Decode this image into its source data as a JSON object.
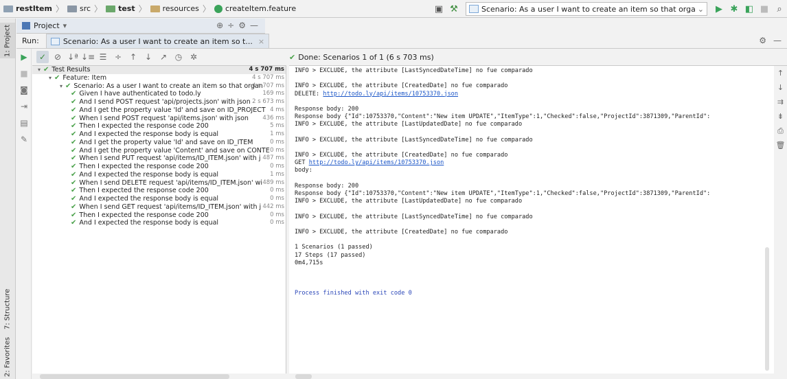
{
  "breadcrumb": [
    {
      "label": "restItem",
      "bold": true,
      "icon": "project-folder-icon",
      "cls": ""
    },
    {
      "label": "src",
      "bold": false,
      "icon": "folder-icon",
      "cls": "src"
    },
    {
      "label": "test",
      "bold": true,
      "icon": "test-folder-icon",
      "cls": "test"
    },
    {
      "label": "resources",
      "bold": false,
      "icon": "resources-folder-icon",
      "cls": "res"
    },
    {
      "label": "createItem.feature",
      "bold": false,
      "icon": "cucumber-feature-icon",
      "cls": "feat"
    }
  ],
  "toolbar": {
    "run_config": "Scenario: As a user I want to create an item so that organize my project"
  },
  "left_strip": {
    "project_tab": "1: Project",
    "structure_tab": "7: Structure",
    "favorites_tab": "2: Favorites"
  },
  "project_panel": {
    "title": "Project",
    "dropdown": "▾"
  },
  "run_panel": {
    "label": "Run:",
    "tab_title": "Scenario: As a user I want to create an item so t..."
  },
  "status": {
    "done_text": "Done: Scenarios 1 of 1  (6 s 703 ms)"
  },
  "tree": [
    {
      "indent": 0,
      "expander": "▾",
      "label": "Test Results",
      "time": "4 s 707 ms",
      "selected": true
    },
    {
      "indent": 1,
      "expander": "▾",
      "label": "Feature: Item",
      "time": "4 s 707 ms"
    },
    {
      "indent": 2,
      "expander": "▾",
      "label": "Scenario: As a user I want to create an item so that organ",
      "time": "4 s 707 ms"
    },
    {
      "indent": 3,
      "label": "Given I have authenticated to todo.ly",
      "time": "169 ms"
    },
    {
      "indent": 3,
      "label": "And I send POST request 'api/projects.json' with json",
      "time": "2 s 673 ms"
    },
    {
      "indent": 3,
      "label": "And I get the property value 'Id' and save on ID_PROJECT",
      "time": "4 ms"
    },
    {
      "indent": 3,
      "label": "When I send POST request 'api/items.json' with json",
      "time": "436 ms"
    },
    {
      "indent": 3,
      "label": "Then I expected the response code 200",
      "time": "5 ms"
    },
    {
      "indent": 3,
      "label": "And I expected the response body is equal",
      "time": "1 ms"
    },
    {
      "indent": 3,
      "label": "And I get the property value 'Id' and save on ID_ITEM",
      "time": "0 ms"
    },
    {
      "indent": 3,
      "label": "And I get the property value 'Content' and save on CONTE",
      "time": "0 ms"
    },
    {
      "indent": 3,
      "label": "When I send PUT request 'api/items/ID_ITEM.json' with j",
      "time": "487 ms"
    },
    {
      "indent": 3,
      "label": "Then I expected the response code 200",
      "time": "0 ms"
    },
    {
      "indent": 3,
      "label": "And I expected the response body is equal",
      "time": "1 ms"
    },
    {
      "indent": 3,
      "label": "When I send DELETE request 'api/items/ID_ITEM.json' wi",
      "time": "489 ms"
    },
    {
      "indent": 3,
      "label": "Then I expected the response code 200",
      "time": "0 ms"
    },
    {
      "indent": 3,
      "label": "And I expected the response body is equal",
      "time": "0 ms"
    },
    {
      "indent": 3,
      "label": "When I send GET request 'api/items/ID_ITEM.json' with j",
      "time": "442 ms"
    },
    {
      "indent": 3,
      "label": "Then I expected the response code 200",
      "time": "0 ms"
    },
    {
      "indent": 3,
      "label": "And I expected the response body is equal",
      "time": "0 ms"
    }
  ],
  "console": [
    {
      "text": "INFO > EXCLUDE, the attribute [LastSyncedDateTime] no fue comparado"
    },
    {
      "text": ""
    },
    {
      "text": "INFO > EXCLUDE, the attribute [CreatedDate] no fue comparado"
    },
    {
      "text": "DELETE: ",
      "link": "http://todo.ly/api/items/10753370.json"
    },
    {
      "text": ""
    },
    {
      "text": "Response body: 200"
    },
    {
      "text": "Response body {\"Id\":10753370,\"Content\":\"New item UPDATE\",\"ItemType\":1,\"Checked\":false,\"ProjectId\":3871309,\"ParentId\":"
    },
    {
      "text": "INFO > EXCLUDE, the attribute [LastUpdatedDate] no fue comparado"
    },
    {
      "text": ""
    },
    {
      "text": "INFO > EXCLUDE, the attribute [LastSyncedDateTime] no fue comparado"
    },
    {
      "text": ""
    },
    {
      "text": "INFO > EXCLUDE, the attribute [CreatedDate] no fue comparado"
    },
    {
      "text": "GET ",
      "link": "http://todo.ly/api/items/10753370.json"
    },
    {
      "text": "body:"
    },
    {
      "text": ""
    },
    {
      "text": "Response body: 200"
    },
    {
      "text": "Response body {\"Id\":10753370,\"Content\":\"New item UPDATE\",\"ItemType\":1,\"Checked\":false,\"ProjectId\":3871309,\"ParentId\":"
    },
    {
      "text": "INFO > EXCLUDE, the attribute [LastUpdatedDate] no fue comparado"
    },
    {
      "text": ""
    },
    {
      "text": "INFO > EXCLUDE, the attribute [LastSyncedDateTime] no fue comparado"
    },
    {
      "text": ""
    },
    {
      "text": "INFO > EXCLUDE, the attribute [CreatedDate] no fue comparado"
    },
    {
      "text": ""
    },
    {
      "text": "1 Scenarios (1 passed)"
    },
    {
      "text": "17 Steps (17 passed)"
    },
    {
      "text": "0m4,715s"
    },
    {
      "text": ""
    },
    {
      "text": ""
    },
    {
      "text": ""
    },
    {
      "text": "Process finished with exit code 0",
      "style": "blue"
    }
  ]
}
